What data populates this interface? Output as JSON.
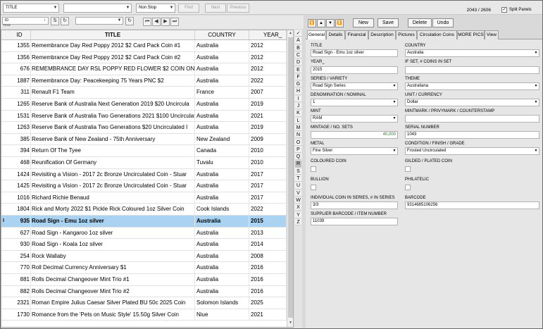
{
  "toolbar": {
    "search_field": "TITLE",
    "search_value": "",
    "mode": "Non Stop",
    "find_label": "Find",
    "next_label": "Next",
    "previous_label": "Previous",
    "record_counter": "2043 / 2606",
    "split_panels_label": "Split Panels",
    "split_panels_checked": "✓"
  },
  "sort": {
    "field": "ID",
    "label": "TITLE",
    "filter_value": ""
  },
  "grid": {
    "columns": [
      "ID",
      "TITLE",
      "COUNTRY",
      "YEAR_"
    ],
    "rows": [
      {
        "id": "1355",
        "title": "Remembrance Day Red Poppy 2012 $2 Card Pack Coin #1",
        "country": "Australia",
        "year": "2012"
      },
      {
        "id": "1356",
        "title": "Remembrance Day Red Poppy 2012 $2 Card Pack Coin #2",
        "country": "Australia",
        "year": "2012"
      },
      {
        "id": "676",
        "title": "REMEMBRANCE DAY RSL POPPY RED FLOWER $2 COIN ON",
        "country": "Australia",
        "year": "2012"
      },
      {
        "id": "1887",
        "title": "Remembrance Day: Peacekeeping 75 Years PNC $2",
        "country": "Australia",
        "year": "2022"
      },
      {
        "id": "311",
        "title": "Renault F1 Team",
        "country": "France",
        "year": "2007"
      },
      {
        "id": "1265",
        "title": "Reserve Bank of Australia Next Generation 2019 $20 Uncircula",
        "country": "Australia",
        "year": "2019"
      },
      {
        "id": "1531",
        "title": "Reserve Bank of Australia Two Generations 2021 $100 Uncirculated",
        "country": "Australia",
        "year": "2021"
      },
      {
        "id": "1263",
        "title": "Reserve Bank of Australia Two Generations $20 Uncirculated I",
        "country": "Australia",
        "year": "2019"
      },
      {
        "id": "385",
        "title": "Reserve Bank of New Zealand - 75th Anniversary",
        "country": "New Zealand",
        "year": "2009"
      },
      {
        "id": "394",
        "title": "Return Of The Tyee",
        "country": "Canada",
        "year": "2010"
      },
      {
        "id": "468",
        "title": "Reunification Of Germany",
        "country": "Tuvalu",
        "year": "2010"
      },
      {
        "id": "1424",
        "title": "Revisiting a Vision - 2017 2c Bronze Uncirculated Coin - Stuar",
        "country": "Australia",
        "year": "2017"
      },
      {
        "id": "1425",
        "title": "Revisiting a Vision - 2017 2c Bronze Uncirculated Coin - Stuar",
        "country": "Australia",
        "year": "2017"
      },
      {
        "id": "1016",
        "title": "Richard Richie Benaud",
        "country": "Australia",
        "year": "2017"
      },
      {
        "id": "1804",
        "title": "Rick and Morty 2022 $1 Pickle Rick Coloured 1oz Silver Coin",
        "country": "Cook Islands",
        "year": "2022"
      },
      {
        "id": "935",
        "title": "Road Sign - Emu 1oz silver",
        "country": "Australia",
        "year": "2015"
      },
      {
        "id": "627",
        "title": "Road Sign - Kangaroo 1oz silver",
        "country": "Australia",
        "year": "2013"
      },
      {
        "id": "930",
        "title": "Road Sign - Koala 1oz silver",
        "country": "Australia",
        "year": "2014"
      },
      {
        "id": "254",
        "title": "Rock Wallaby",
        "country": "Australia",
        "year": "2008"
      },
      {
        "id": "770",
        "title": "Roll Decimal Currency Anniversary $1",
        "country": "Australia",
        "year": "2016"
      },
      {
        "id": "881",
        "title": "Rolls Decimal Changeover Mint Trio #1",
        "country": "Australia",
        "year": "2016"
      },
      {
        "id": "882",
        "title": "Rolls Decimal Changeover Mint Trio #2",
        "country": "Australia",
        "year": "2016"
      },
      {
        "id": "2321",
        "title": "Roman Empire Julius Caesar Silver Plated BU 50c 2025 Coin",
        "country": "Solomon Islands",
        "year": "2025"
      },
      {
        "id": "1730",
        "title": "Romance from the 'Pets on Music Style' 15.50g Silver Coin",
        "country": "Niue",
        "year": "2021"
      }
    ],
    "selected_row_marker": "I"
  },
  "alpha_index": [
    "✓",
    "A",
    "B",
    "C",
    "D",
    "E",
    "F",
    "G",
    "H",
    "I",
    "J",
    "K",
    "L",
    "M",
    "N",
    "O",
    "P",
    "Q",
    "R",
    "S",
    "T",
    "U",
    "V",
    "W",
    "X",
    "Y",
    "Z"
  ],
  "actions": {
    "new": "New",
    "save": "Save",
    "delete": "Delete",
    "undo": "Undo"
  },
  "tabs": [
    "General",
    "Details",
    "Financial",
    "Description",
    "Pictures",
    "Circulation Coins",
    "MORE PICS",
    "View"
  ],
  "form": {
    "title_label": "TITLE",
    "title": "Road Sign - Emu 1oz silver",
    "country_label": "COUNTRY",
    "country": "Australia",
    "year_label": "YEAR_",
    "year": "2015",
    "ifset_label": "IF SET, # COINS IN SET",
    "ifset": "",
    "series_label": "SERIES / VARIETY",
    "series": "Road Sign Series",
    "theme_label": "THEME",
    "theme": "Australiana",
    "denom_label": "DENOMINATION / NOMINAL",
    "denom": "1",
    "unit_label": "UNIT / CURRENCY",
    "unit": "Dollar",
    "mint_label": "MINT",
    "mint": "RAM",
    "mintmark_label": "MINTMARK / PRIVYMARK / COUNTERSTAMP",
    "mintmark": "",
    "mintage_label": "MINTAGE / NO. SETS",
    "mintage": "40,000",
    "serial_label": "SERIAL NUMBER",
    "serial": "1043",
    "metal_label": "METAL",
    "metal": "Fine Silver",
    "condition_label": "CONDITION / FINISH / GRADE",
    "condition": "Frosted Uncirculated",
    "coloured_label": "COLOURED COIN",
    "gilded_label": "GILDED / PLATED COIN",
    "bullion_label": "BULLION",
    "philatelic_label": "PHILATELIC",
    "individual_label": "INDIVIDUAL COIN IN SERIES, # IN SERIES",
    "individual": "3/3",
    "barcode_label": "BARCODE",
    "barcode": "9314685106256",
    "supplier_label": "SUPPLIER BARCODE / ITEM NUMBER",
    "supplier": "11039"
  }
}
